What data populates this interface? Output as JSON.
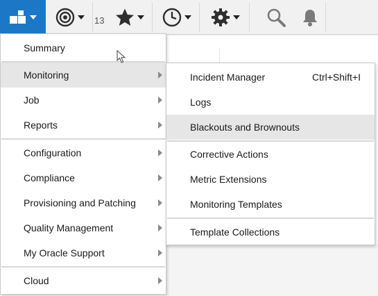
{
  "toolbar": {
    "partial_text": "13",
    "colors": {
      "accent": "#1b78c7",
      "icon_dark": "#2e2e2e",
      "icon_grey": "#7a7a7a"
    }
  },
  "main_menu": {
    "items": [
      {
        "label": "Summary",
        "has_submenu": false
      },
      {
        "label": "Monitoring",
        "has_submenu": true,
        "active": true
      },
      {
        "label": "Job",
        "has_submenu": true
      },
      {
        "label": "Reports",
        "has_submenu": true
      },
      {
        "label": "Configuration",
        "has_submenu": true
      },
      {
        "label": "Compliance",
        "has_submenu": true
      },
      {
        "label": "Provisioning and Patching",
        "has_submenu": true
      },
      {
        "label": "Quality Management",
        "has_submenu": true
      },
      {
        "label": "My Oracle Support",
        "has_submenu": true
      },
      {
        "label": "Cloud",
        "has_submenu": true
      }
    ]
  },
  "sub_menu": {
    "items": [
      {
        "label": "Incident Manager",
        "shortcut": "Ctrl+Shift+I"
      },
      {
        "label": "Logs"
      },
      {
        "label": "Blackouts and Brownouts",
        "active": true
      },
      {
        "label": "Corrective Actions"
      },
      {
        "label": "Metric Extensions"
      },
      {
        "label": "Monitoring Templates"
      },
      {
        "label": "Template Collections"
      }
    ]
  }
}
